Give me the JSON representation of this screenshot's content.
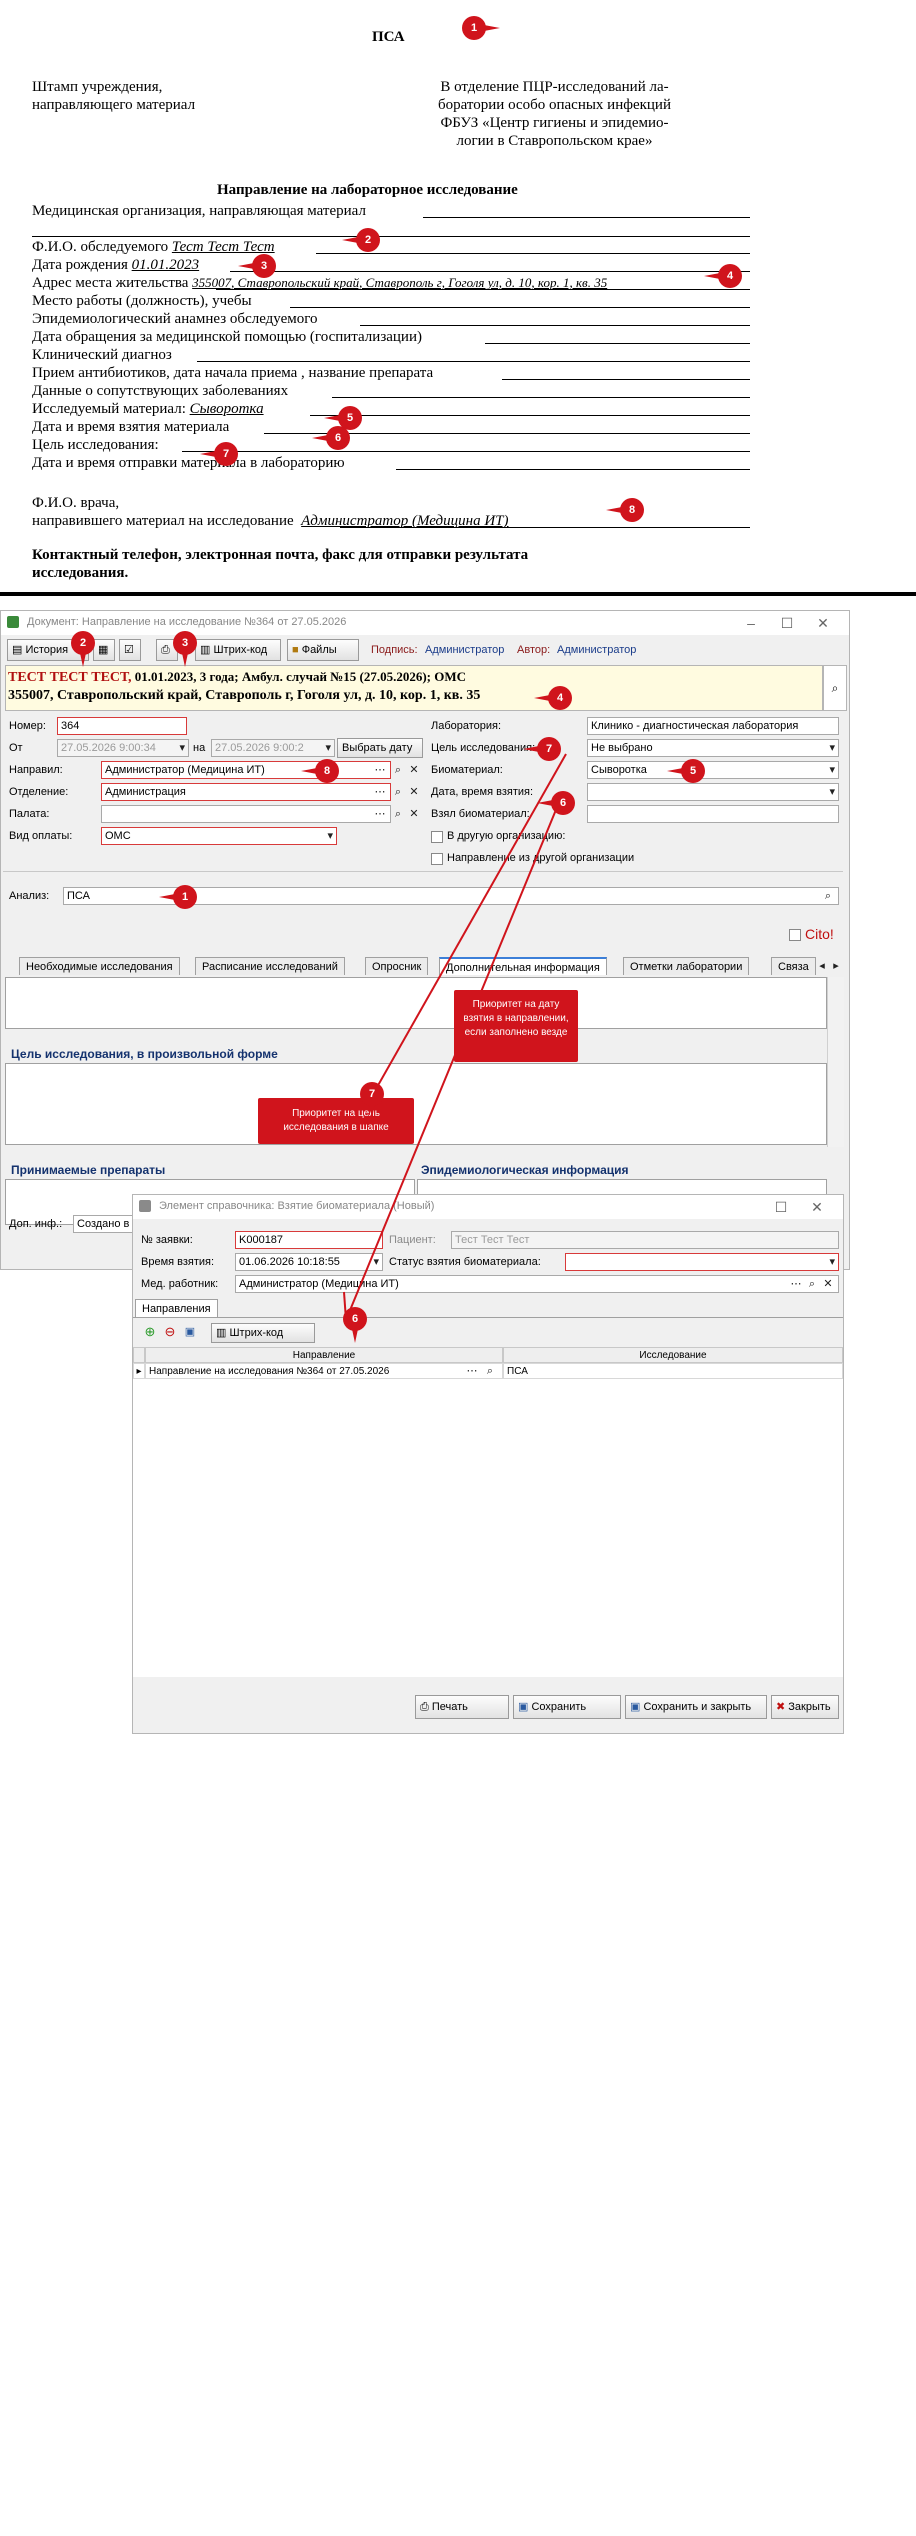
{
  "form": {
    "title": "ПСА",
    "stamp": "Штамп учреждения,\nнаправляющего материал",
    "dept": "В отделение ПЦР-исследований ла-\nборатории особо опасных инфекций\nФБУЗ «Центр гигиены и эпидемио-\nлогии в Ставропольском крае»",
    "heading": "Направление на лабораторное исследование",
    "org_label": "Медицинская организация, направляющая материал",
    "fio_label": "Ф.И.О. обследуемого",
    "fio_value": "Тест Тест Тест",
    "dob_label": "Дата рождения",
    "dob_value": "01.01.2023",
    "addr_label": "Адрес места жительства",
    "addr_value": "355007, Ставропольский край, Ставрополь г, Гоголя ул, д. 10, кор. 1, кв. 35",
    "work_label": "Место работы (должность), учебы",
    "epid_label": "Эпидемиологический анамнез обследуемого",
    "visit_label": "Дата обращения за медицинской помощью (госпитализации)",
    "diag_label": "Клинический диагноз",
    "antib_label": "Прием антибиотиков, дата начала приема , название препарата",
    "comorb_label": "Данные о сопутствующих заболеваниях",
    "mat_label": "Исследуемый материал:",
    "mat_value": "Сыворотка",
    "datetime_label": "Дата и время взятия материала",
    "goal_label": "Цель исследования:",
    "send_label": "Дата и время отправки материала в лабораторию",
    "doc_label1": "Ф.И.О. врача,",
    "doc_label2": "направившего материал на исследование",
    "doc_value": "Администратор (Медицина ИТ)",
    "contact": "Контактный телефон, электронная почта, факс для отправки результата\nисследования."
  },
  "window1": {
    "title": "Документ: Направление на исследование №364 от 27.05.2026",
    "toolbar": {
      "history": "История",
      "barcode": "Штрих-код",
      "files": "Файлы",
      "sign_label": "Подпись:",
      "sign_value": "Администратор",
      "author_label": "Автор:",
      "author_value": "Администратор"
    },
    "patient_line1_name": "ТЕСТ ТЕСТ ТЕСТ,",
    "patient_line1_rest": " 01.01.2023, 3 года; Амбул. случай №15 (27.05.2026); ОМС",
    "patient_line2": "355007, Ставропольский край, Ставрополь г, Гоголя ул, д. 10, кор. 1, кв. 35",
    "number_label": "Номер:",
    "number_value": "364",
    "from_label": "От",
    "from_value": "27.05.2026 9:00:34",
    "to_label": "на",
    "to_value": "27.05.2026 9:00:2",
    "choose_date": "Выбрать дату",
    "sent_label": "Направил:",
    "sent_value": "Администратор (Медицина ИТ)",
    "dept_label": "Отделение:",
    "dept_value": "Администрация",
    "ward_label": "Палата:",
    "pay_label": "Вид оплаты:",
    "pay_value": "ОМС",
    "lab_label": "Лаборатория:",
    "lab_value": "Клинико - диагностическая лаборатория",
    "goal_label": "Цель исследования:",
    "goal_value": "Не выбрано",
    "bio_label": "Биоматериал:",
    "bio_value": "Сыворотка",
    "dt_label": "Дата, время взятия:",
    "took_label": "Взял биоматериал:",
    "other_org": "В другую организацию:",
    "from_other_org": "Направление из другой организации",
    "analysis_label": "Анализ:",
    "analysis_value": "ПСА",
    "cito": "Cito!",
    "tabs": [
      "Необходимые исследования",
      "Расписание исследований",
      "Опросник",
      "Дополнительная информация",
      "Отметки лаборатории",
      "Связа"
    ],
    "goal_section": "Цель исследования, в произвольной форме",
    "drugs_section": "Принимаемые препараты",
    "epid_section": "Эпидемиологическая информация",
    "extra_label": "Доп. инф.:",
    "extra_value": "Создано в"
  },
  "window2": {
    "title": "Элемент справочника: Взятие биоматериала (Новый)",
    "order_label": "№ заявки:",
    "order_value": "K000187",
    "patient_label": "Пациент:",
    "patient_value": "Тест Тест Тест",
    "time_label": "Время взятия:",
    "time_value": "01.06.2026 10:18:55",
    "status_label": "Статус взятия биоматериала:",
    "worker_label": "Мед. работник:",
    "worker_value": "Администратор (Медицина ИТ)",
    "tab": "Направления",
    "barcode": "Штрих-код",
    "col1": "Направление",
    "col2": "Исследование",
    "row_dir": "Направление на исследования №364 от 27.05.2026",
    "row_test": "ПСА",
    "btn_print": "Печать",
    "btn_save": "Сохранить",
    "btn_save_close": "Сохранить и закрыть",
    "btn_close": "Закрыть"
  },
  "callouts": {
    "c1": "Приоритет на дату взятия в направлении, если заполнено везде",
    "c2": "Приоритет на цель исследования в шапке"
  },
  "markers": [
    "1",
    "2",
    "3",
    "4",
    "5",
    "6",
    "7",
    "8"
  ],
  "colors": {
    "marker": "#d0141c",
    "required": "#d83a3a",
    "header_bg": "#fffbe0",
    "tab_accent": "#3c7fd8"
  }
}
